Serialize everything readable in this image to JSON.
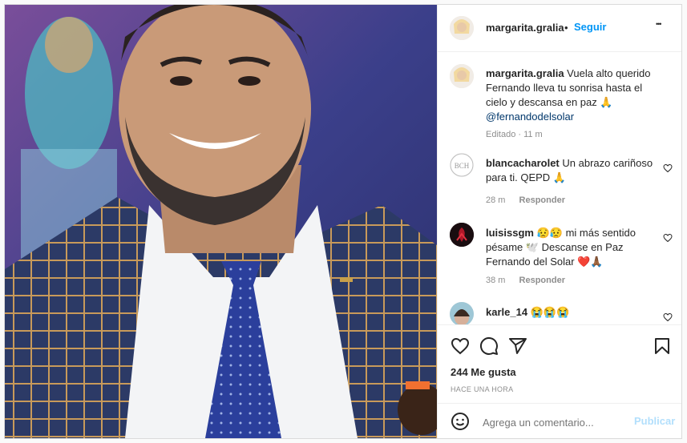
{
  "post": {
    "author": "margarita.gralia",
    "follow_separator": "•",
    "follow_label": "Seguir",
    "more_label": "•••",
    "caption_text": "Vuela alto querido Fernando lleva tu sonrisa hasta el cielo y descansa en paz 🙏",
    "caption_mention": "@fernandodelsolar",
    "caption_meta": "Editado · 11 m"
  },
  "comments": [
    {
      "user": "blancacharolet",
      "text": "Un abrazo cariñoso para ti. QEPD 🙏",
      "time": "28 m",
      "reply_label": "Responder"
    },
    {
      "user": "luisissgm",
      "text": "😥😥 mi más sentido pésame 🕊️ Descanse en Paz Fernando del Solar ❤️🙏🏾",
      "time": "38 m",
      "reply_label": "Responder"
    },
    {
      "user": "karle_14",
      "text": "😭😭😭"
    }
  ],
  "stats": {
    "likes": "244 Me gusta",
    "time": "HACE UNA HORA"
  },
  "add_comment": {
    "placeholder": "Agrega un comentario...",
    "publish_label": "Publicar"
  },
  "icons": [
    "heart-icon",
    "comment-icon",
    "share-icon",
    "bookmark-icon",
    "emoji-icon",
    "more-icon"
  ],
  "colors": {
    "accent": "#0095f6",
    "publish_disabled": "#b2dffc",
    "text": "#262626",
    "muted": "#8e8e8e"
  }
}
